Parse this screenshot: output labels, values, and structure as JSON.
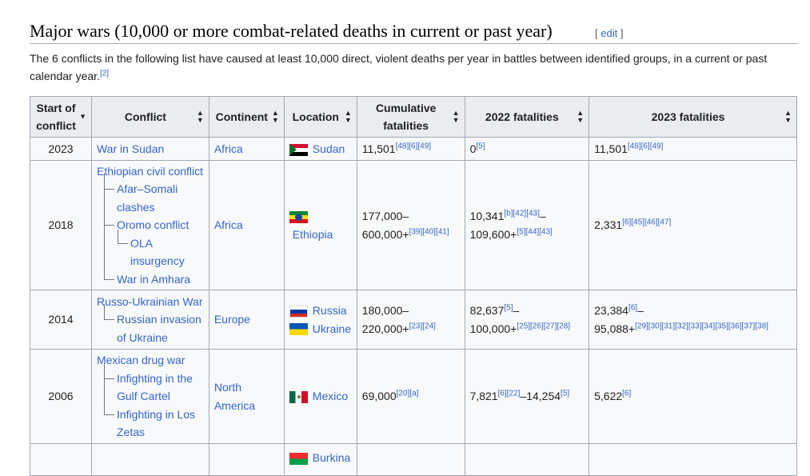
{
  "heading": {
    "title": "Major wars (10,000 or more combat-related deaths in current or past year)",
    "edit_open": "[ ",
    "edit_label": "edit",
    "edit_close": " ]"
  },
  "intro": {
    "text": "The 6 conflicts in the following list have caused at least 10,000 direct, violent deaths per year in battles between identified groups, in a current or past calendar year.",
    "ref": "[2]"
  },
  "table": {
    "headers": {
      "start": "Start of conflict",
      "conflict": "Conflict",
      "continent": "Continent",
      "location": "Location",
      "cumulative": "Cumulative fatalities",
      "f2022": "2022 fatalities",
      "f2023": "2023 fatalities"
    },
    "icons": {
      "sort_both": "sort-arrows-icon",
      "sort_down": "sort-down-icon"
    },
    "rows": [
      {
        "start": "2023",
        "conflict": "War in Sudan",
        "continent": "Africa",
        "location": "Sudan",
        "cum_value": "11,501",
        "cum_refs": "[48][6][49]",
        "f2022_value": "0",
        "f2022_refs": "[5]",
        "f2023_value": "11,501",
        "f2023_refs": "[48][6][49]"
      },
      {
        "start": "2018",
        "conflict": "Ethiopian civil conflict",
        "sub1": "Afar–Somali clashes",
        "sub2": "Oromo conflict",
        "sub2a": "OLA insurgency",
        "sub3": "War in Amhara",
        "continent": "Africa",
        "location": "Ethiopia",
        "cum_value1": "177,000–",
        "cum_value2": "600,000+",
        "cum_refs": "[39][40][41]",
        "f2022_value1": "10,341",
        "f2022_refs1": "[b][42][43]",
        "f2022_dash": "–",
        "f2022_value2": "109,600+",
        "f2022_refs2": "[5][44][43]",
        "f2023_value": "2,331",
        "f2023_refs": "[6][45][46][47]"
      },
      {
        "start": "2014",
        "conflict": "Russo-Ukrainian War",
        "sub1": "Russian invasion of Ukraine",
        "continent": "Europe",
        "location1": "Russia",
        "location2": "Ukraine",
        "cum_value1": "180,000–",
        "cum_value2": "220,000+",
        "cum_refs": "[23][24]",
        "f2022_value1": "82,637",
        "f2022_refs1": "[5]",
        "f2022_dash": "–",
        "f2022_value2": "100,000+",
        "f2022_refs2": "[25][26][27][28]",
        "f2023_value1": "23,384",
        "f2023_refs1": "[6]",
        "f2023_dash": "–",
        "f2023_value2": "95,088+",
        "f2023_refs2": "[29][30][31][32][33][34][35][36][37][38]"
      },
      {
        "start": "2006",
        "conflict": "Mexican drug war",
        "sub1": "Infighting in the Gulf Cartel",
        "sub2": "Infighting in Los Zetas",
        "continent": "North America",
        "location": "Mexico",
        "cum_value": "69,000",
        "cum_refs": "[20][a]",
        "f2022_value1": "7,821",
        "f2022_refs1": "[6][22]",
        "f2022_dash": "–",
        "f2022_value2": "14,254",
        "f2022_refs2": "[5]",
        "f2023_value": "5,622",
        "f2023_refs": "[6]"
      },
      {
        "location": "Burkina"
      }
    ]
  },
  "colors": {
    "link": "#3366cc",
    "border": "#a2a9b1",
    "header_bg": "#eaecf0",
    "cell_bg": "#f8f9fa"
  }
}
